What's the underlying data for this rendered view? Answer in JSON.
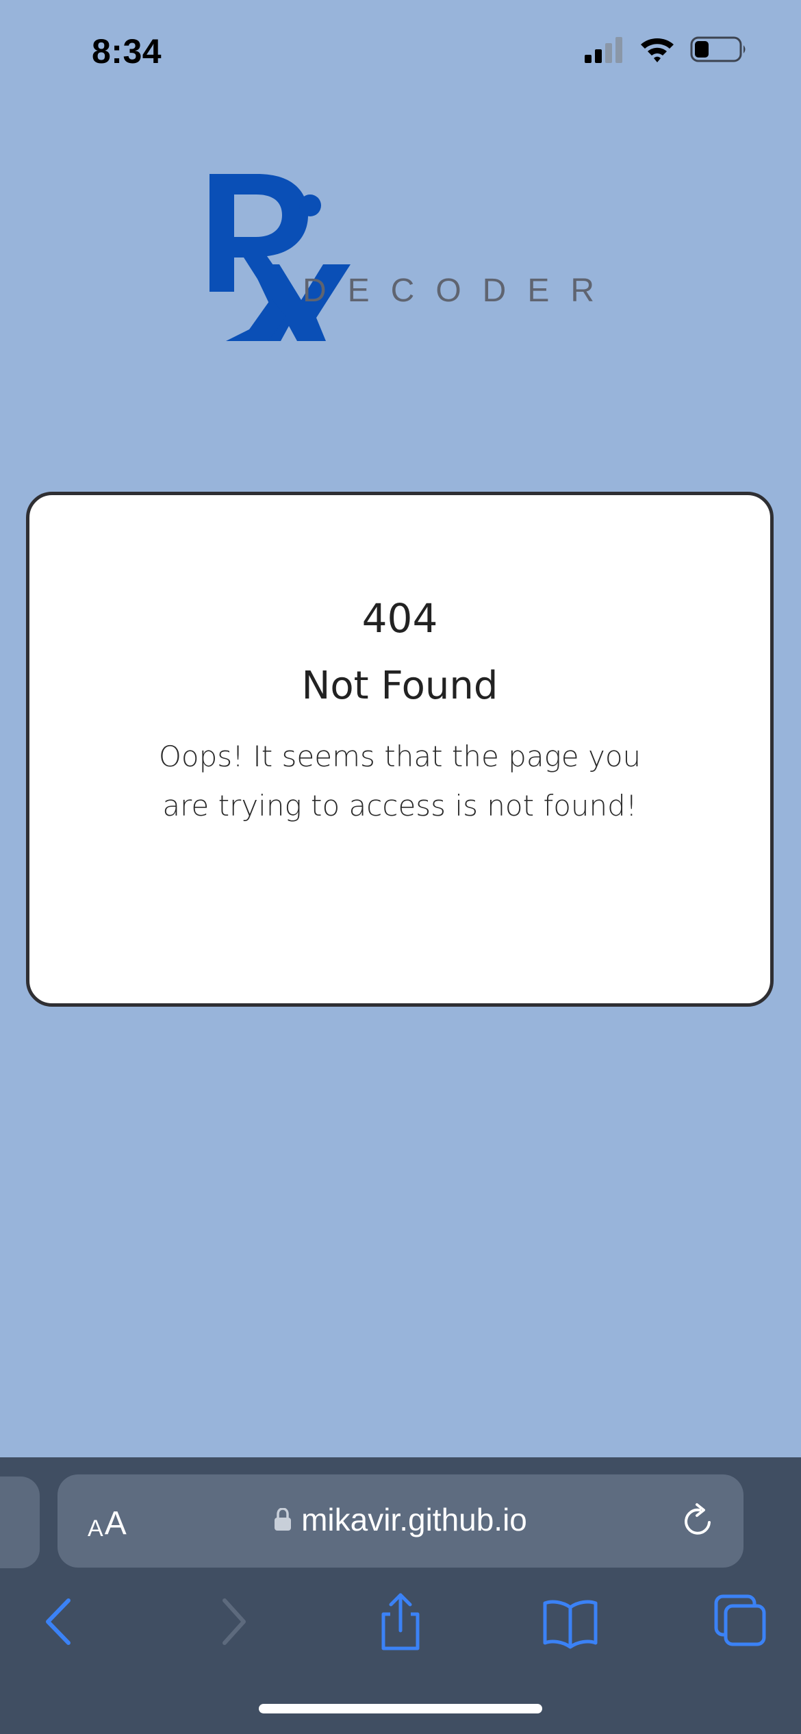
{
  "status_bar": {
    "time": "8:34",
    "icons": [
      "cellular-signal-icon",
      "wifi-icon",
      "battery-icon"
    ]
  },
  "logo": {
    "mark": "RX",
    "wordmark": "DECODER",
    "colors": {
      "mark": "#0a4fb6",
      "wordmark": "#5f6470"
    }
  },
  "card": {
    "code": "404",
    "title": "Not Found",
    "message": "Oops! It seems that the page you are trying to access is not found!"
  },
  "browser": {
    "text_size_small": "A",
    "text_size_large": "A",
    "url": "mikavir.github.io",
    "icons": {
      "lock": "lock-icon",
      "reload": "reload-icon",
      "back": "chevron-left-icon",
      "forward": "chevron-right-icon",
      "share": "share-icon",
      "bookmarks": "bookmarks-icon",
      "tabs": "tabs-icon"
    }
  },
  "colors": {
    "page_background": "#98b4da",
    "card_background": "#ffffff",
    "card_border": "#2f2f33",
    "browser_bar": "#404e62",
    "accent_blue": "#3b82f6"
  }
}
